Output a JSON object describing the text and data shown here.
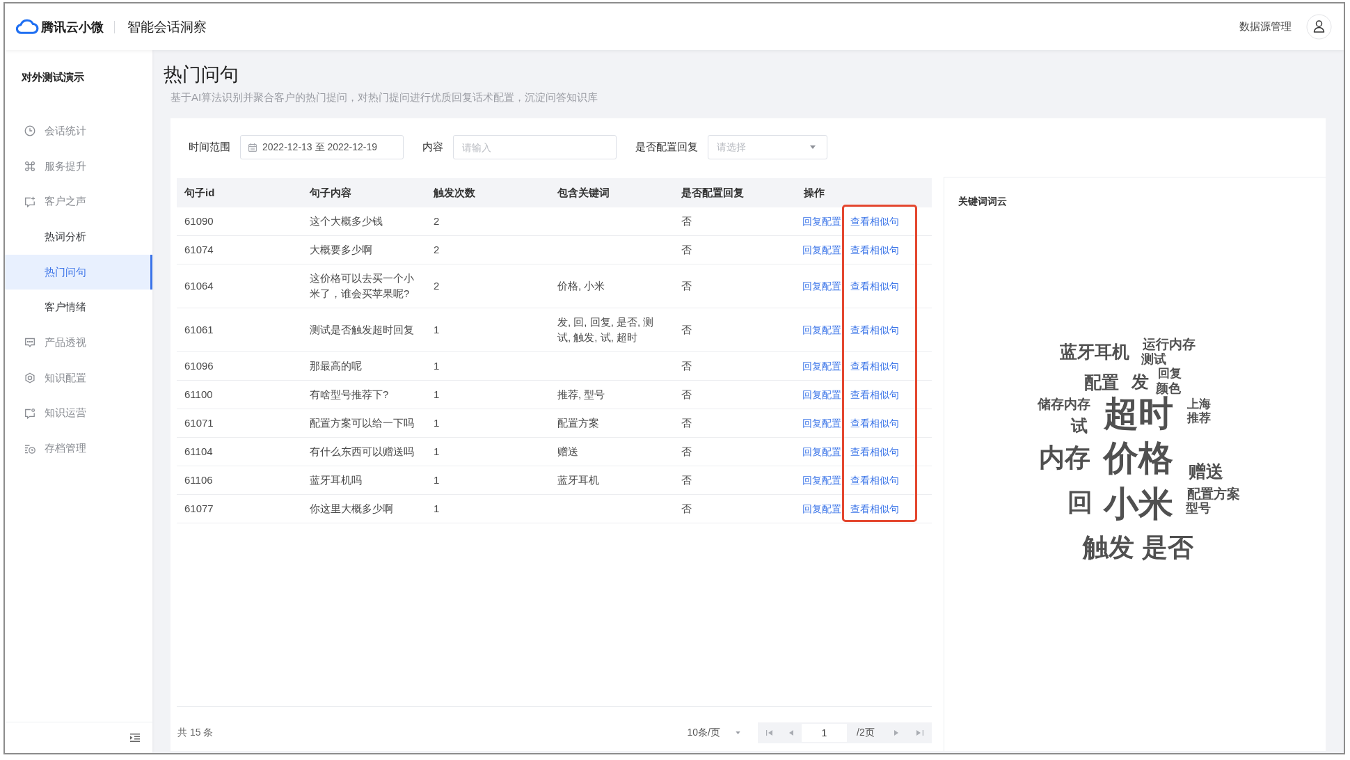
{
  "app_bar": {
    "brand": "腾讯云小微",
    "product": "智能会话洞察",
    "data_source_link": "数据源管理"
  },
  "sidebar": {
    "workspace": "对外测试演示",
    "items": [
      {
        "label": "会话统计",
        "selected": false
      },
      {
        "label": "服务提升",
        "selected": false
      },
      {
        "label": "客户之声",
        "selected": false,
        "children": [
          {
            "label": "热词分析",
            "selected": false
          },
          {
            "label": "热门问句",
            "selected": true
          },
          {
            "label": "客户情绪",
            "selected": false
          }
        ]
      },
      {
        "label": "产品透视",
        "selected": false
      },
      {
        "label": "知识配置",
        "selected": false
      },
      {
        "label": "知识运营",
        "selected": false
      },
      {
        "label": "存档管理",
        "selected": false
      }
    ]
  },
  "page": {
    "title": "热门问句",
    "description": "基于AI算法识别并聚合客户的热门提问，对热门提问进行优质回复话术配置，沉淀问答知识库"
  },
  "filters": [
    {
      "kind": "date_range",
      "label": "时间范围",
      "value": "2022-12-13 至 2022-12-19"
    },
    {
      "kind": "text",
      "label": "内容",
      "placeholder": "请输入"
    },
    {
      "kind": "select",
      "label": "是否配置回复",
      "placeholder": "请选择"
    }
  ],
  "table": {
    "columns": [
      "句子id",
      "句子内容",
      "触发次数",
      "包含关键词",
      "是否配置回复",
      "操作"
    ],
    "rows": [
      {
        "id": "61090",
        "content": "这个大概多少钱",
        "count": "2",
        "configured": "否",
        "actions": [
          "回复配置",
          "查看相似句"
        ]
      },
      {
        "id": "61074",
        "content": "大概要多少啊",
        "count": "2",
        "configured": "否",
        "actions": [
          "回复配置",
          "查看相似句"
        ]
      },
      {
        "id": "61064",
        "content": "这价格可以去买一个小米了，谁会买苹果呢?",
        "count": "2",
        "keywords": "价格, 小米",
        "configured": "否",
        "actions": [
          "回复配置",
          "查看相似句"
        ]
      },
      {
        "id": "61061",
        "content": "测试是否触发超时回复",
        "count": "1",
        "keywords": "发, 回, 回复, 是否, 测试, 触发, 试, 超时",
        "configured": "否",
        "actions": [
          "回复配置",
          "查看相似句"
        ]
      },
      {
        "id": "61096",
        "content": "那最高的呢",
        "count": "1",
        "configured": "否",
        "actions": [
          "回复配置",
          "查看相似句"
        ]
      },
      {
        "id": "61100",
        "content": "有啥型号推荐下?",
        "count": "1",
        "keywords": "推荐, 型号",
        "configured": "否",
        "actions": [
          "回复配置",
          "查看相似句"
        ]
      },
      {
        "id": "61071",
        "content": "配置方案可以给一下吗",
        "count": "1",
        "keywords": "配置方案",
        "configured": "否",
        "actions": [
          "回复配置",
          "查看相似句"
        ]
      },
      {
        "id": "61104",
        "content": "有什么东西可以赠送吗",
        "count": "1",
        "keywords": "赠送",
        "configured": "否",
        "actions": [
          "回复配置",
          "查看相似句"
        ]
      },
      {
        "id": "61106",
        "content": "蓝牙耳机吗",
        "count": "1",
        "keywords": "蓝牙耳机",
        "configured": "否",
        "actions": [
          "回复配置",
          "查看相似句"
        ]
      },
      {
        "id": "61077",
        "content": "你这里大概多少啊",
        "count": "1",
        "configured": "否",
        "actions": [
          "回复配置",
          "查看相似句"
        ]
      }
    ]
  },
  "pagination": {
    "total": "共 15 条",
    "page_size": "10条/页",
    "page": "1",
    "page_count": "/2页"
  },
  "keyword_cloud": {
    "title": "关键词词云",
    "words": [
      "蓝牙耳机",
      "运行内存",
      "测试",
      "配置",
      "发",
      "回复",
      "颜色",
      "储存内存",
      "超时",
      "上海",
      "推荐",
      "试",
      "内存",
      "价格",
      "赠送",
      "回",
      "小米",
      "配置方案",
      "型号",
      "触发",
      "是否"
    ]
  }
}
